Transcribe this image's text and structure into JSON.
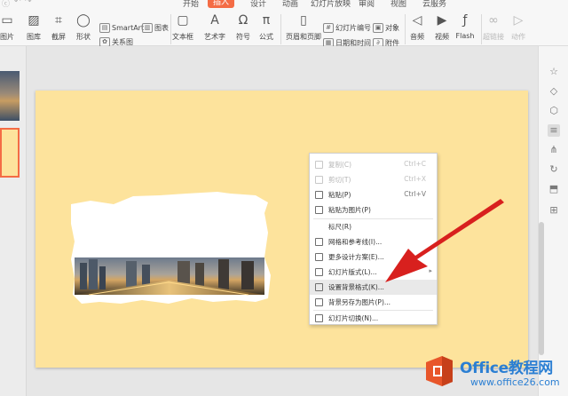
{
  "app": {
    "quick_access": [
      "ⓒ",
      "↶",
      "↷"
    ],
    "tabs": [
      {
        "label": "开始",
        "active": false
      },
      {
        "label": "插入",
        "active": true
      },
      {
        "label": "设计",
        "active": false
      },
      {
        "label": "动画",
        "active": false
      },
      {
        "label": "幻灯片放映",
        "active": false
      },
      {
        "label": "审阅",
        "active": false
      },
      {
        "label": "视图",
        "active": false
      },
      {
        "label": "云服务",
        "active": false
      }
    ],
    "accent_color": "#f46c45"
  },
  "ribbon": {
    "picture": "图片",
    "gallery": "图库",
    "screenshot": "截屏",
    "shape": "形状",
    "smartart": "SmartArt",
    "chart": "图表",
    "relation": "关系图",
    "textbox": "文本框",
    "wordart": "艺术字",
    "symbol": "符号",
    "formula": "公式",
    "header_footer": "页眉和页脚",
    "slide_number": "幻灯片编号",
    "object": "对象",
    "date_time": "日期和时间",
    "attachment": "附件",
    "audio": "音频",
    "video": "视频",
    "flash": "Flash",
    "hyperlink": "超链接",
    "action": "动作"
  },
  "context_menu": {
    "items": [
      {
        "icon": "copy-icon",
        "label": "复制(C)",
        "shortcut": "Ctrl+C",
        "disabled": true
      },
      {
        "icon": "cut-icon",
        "label": "剪切(T)",
        "shortcut": "Ctrl+X",
        "disabled": true
      },
      {
        "icon": "paste-icon",
        "label": "粘贴(P)",
        "shortcut": "Ctrl+V",
        "disabled": false
      },
      {
        "icon": "paste-as-picture-icon",
        "label": "粘贴为图片(P)",
        "shortcut": "",
        "disabled": false
      },
      {
        "icon": "",
        "label": "标尺(R)",
        "shortcut": "",
        "disabled": false
      },
      {
        "icon": "grid-icon",
        "label": "网格和参考线(I)...",
        "shortcut": "",
        "disabled": false
      },
      {
        "icon": "design-icon",
        "label": "更多设计方案(E)...",
        "shortcut": "",
        "disabled": false
      },
      {
        "icon": "layout-icon",
        "label": "幻灯片版式(L)...",
        "shortcut": "",
        "disabled": false,
        "submenu": true
      },
      {
        "icon": "background-format-icon",
        "label": "设置背景格式(K)...",
        "shortcut": "",
        "disabled": false,
        "highlighted": true
      },
      {
        "icon": "save-background-icon",
        "label": "背景另存为图片(P)...",
        "shortcut": "",
        "disabled": false
      },
      {
        "icon": "transition-icon",
        "label": "幻灯片切换(N)...",
        "shortcut": "",
        "disabled": false
      }
    ]
  },
  "slide": {
    "background_color": "#fde39c"
  },
  "watermark": {
    "brand": "Office教程网",
    "site": "www.office26.com",
    "brand_color": "#2b7fd3"
  }
}
